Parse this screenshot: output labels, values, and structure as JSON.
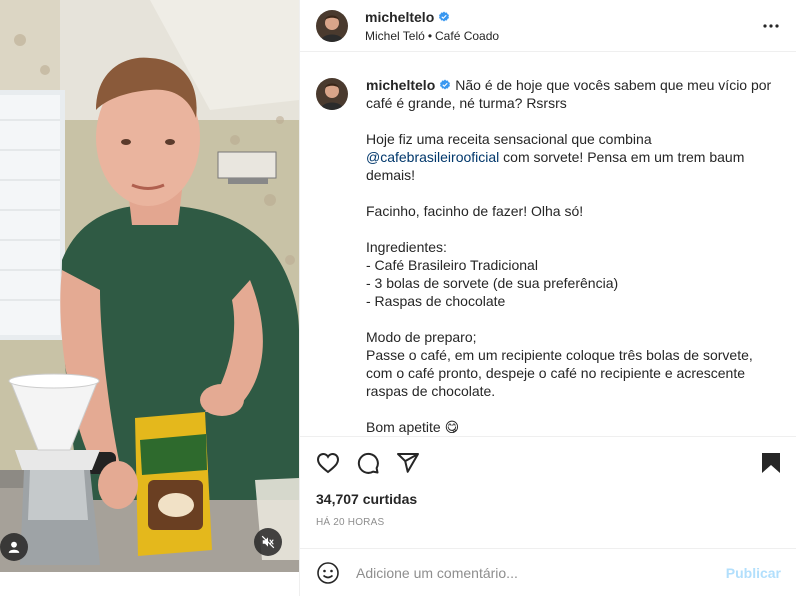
{
  "header": {
    "username": "micheltelo",
    "verified": true,
    "author_name": "Michel Teló",
    "separator": "•",
    "audio": "Café Coado",
    "more_icon": "more-horizontal-icon"
  },
  "caption": {
    "username": "micheltelo",
    "lines": [
      "Não é de hoje que vocês sabem que meu vício por café é grande, né turma? Rsrsrs",
      "",
      "Hoje fiz uma receita sensacional que combina",
      "com sorvete! Pensa em um trem baum demais!",
      "",
      "Facinho, facinho de fazer! Olha só!",
      "",
      "Ingredientes:",
      "- Café Brasileiro Tradicional",
      "- 3 bolas de sorvete (de sua preferência)",
      "- Raspas de chocolate",
      "",
      "Modo de preparo;",
      "Passe o café, em um recipiente coloque três bolas de sorvete, com o café pronto, despeje o café no recipiente e acrescente raspas de chocolate.",
      "",
      "Bom apetite 😋"
    ],
    "mention": "@cafebrasileirooficial"
  },
  "actions": {
    "like_icon": "heart-icon",
    "comment_icon": "comment-icon",
    "share_icon": "share-icon",
    "save_icon": "bookmark-icon"
  },
  "likes": "34,707 curtidas",
  "time": "HÁ 20 HORAS",
  "comment_box": {
    "emoji_icon": "smiley-icon",
    "placeholder": "Adicione um comentário...",
    "publish_label": "Publicar"
  },
  "media": {
    "mute_icon": "muted-speaker-icon",
    "tag_icon": "user-tag-icon",
    "colors": {
      "shirt": "#2f5a44",
      "wall": "#c9c3a8",
      "bag": "#e4b81c"
    }
  }
}
